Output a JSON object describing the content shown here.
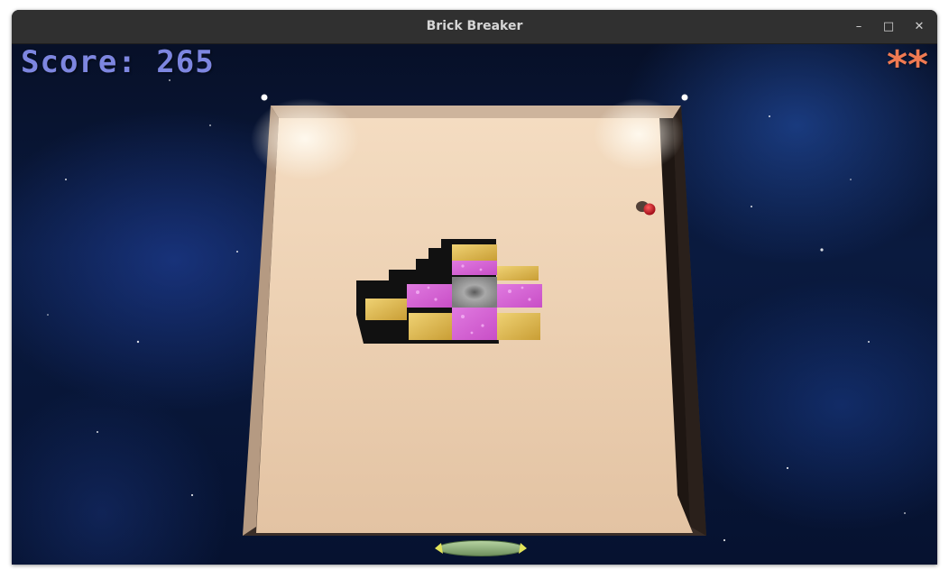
{
  "window": {
    "title": "Brick Breaker",
    "minimize": "–",
    "maximize": "□",
    "close": "✕"
  },
  "hud": {
    "score_text": "Score: 265",
    "lives_text": "**"
  },
  "colors": {
    "score": "#7d86e0",
    "lives": "#f07a52",
    "board": "#e9cdb0",
    "brick_pink": "#d860d6",
    "brick_gold": "#d9b64a",
    "brick_gray": "#8a8a8a",
    "ball": "#cc1f2a",
    "paddle": "#8fb47a"
  }
}
